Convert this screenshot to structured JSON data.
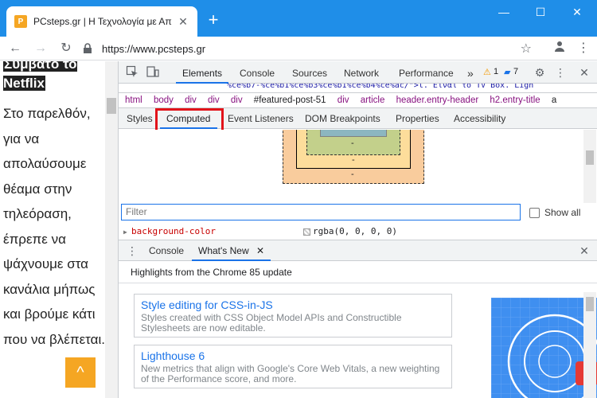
{
  "window": {
    "tab_title": "PCsteps.gr | Η Τεχνολογία με Απλά Λόγια",
    "tab_close": "✕",
    "new_tab": "+",
    "minimize": "—",
    "maximize": "☐",
    "close": "✕",
    "accent": "#1f8ee8"
  },
  "toolbar": {
    "back": "←",
    "forward": "→",
    "reload": "↻",
    "url": "https://www.pcsteps.gr",
    "lock_icon": "lock-icon",
    "star_icon": "star-icon"
  },
  "page": {
    "heading": "Συμβατό το Netflix",
    "body": "Στο παρελθόν, για να απολαύσουμε θέαμα στην τηλεόραση, έπρεπε να ψάχνουμε στα κανάλια μήπως και βρούμε κάτι που να βλέπεται.",
    "scroll_top_label": "^"
  },
  "devtools": {
    "tabs": [
      "Elements",
      "Console",
      "Sources",
      "Network",
      "Performance"
    ],
    "more": "»",
    "warnings": "1",
    "messages": "7",
    "dom_snippet": "%ce%b7-%ce%b1%ce%b3%ce%b1%ce%b4%ce%ac/\">l. Είναι το TV Box. Ligh",
    "breadcrumbs": [
      "html",
      "body",
      "div",
      "div",
      "div",
      "#featured-post-51",
      "div",
      "article",
      "header.entry-header",
      "h2.entry-title",
      "a"
    ],
    "sub_tabs": [
      "Styles",
      "Computed",
      "Event Listeners",
      "DOM Breakpoints",
      "Properties",
      "Accessibility"
    ],
    "box_model": {
      "content_dash": "-",
      "padding_dash": "-",
      "border_dash": "-",
      "margin_dash": "-"
    },
    "filter_placeholder": "Filter",
    "show_all": "Show all",
    "property": {
      "name": "background-color",
      "value": "rgba(0, 0, 0, 0)"
    },
    "drawer_tabs": [
      "Console",
      "What's New"
    ],
    "drawer_close": "✕",
    "whats_new_header": "Highlights from the Chrome 85 update",
    "cards": [
      {
        "title": "Style editing for CSS-in-JS",
        "desc": "Styles created with CSS Object Model APIs and Constructible Stylesheets are now editable."
      },
      {
        "title": "Lighthouse 6",
        "desc": "New metrics that align with Google's Core Web Vitals, a new weighting of the Performance score, and more."
      }
    ]
  }
}
